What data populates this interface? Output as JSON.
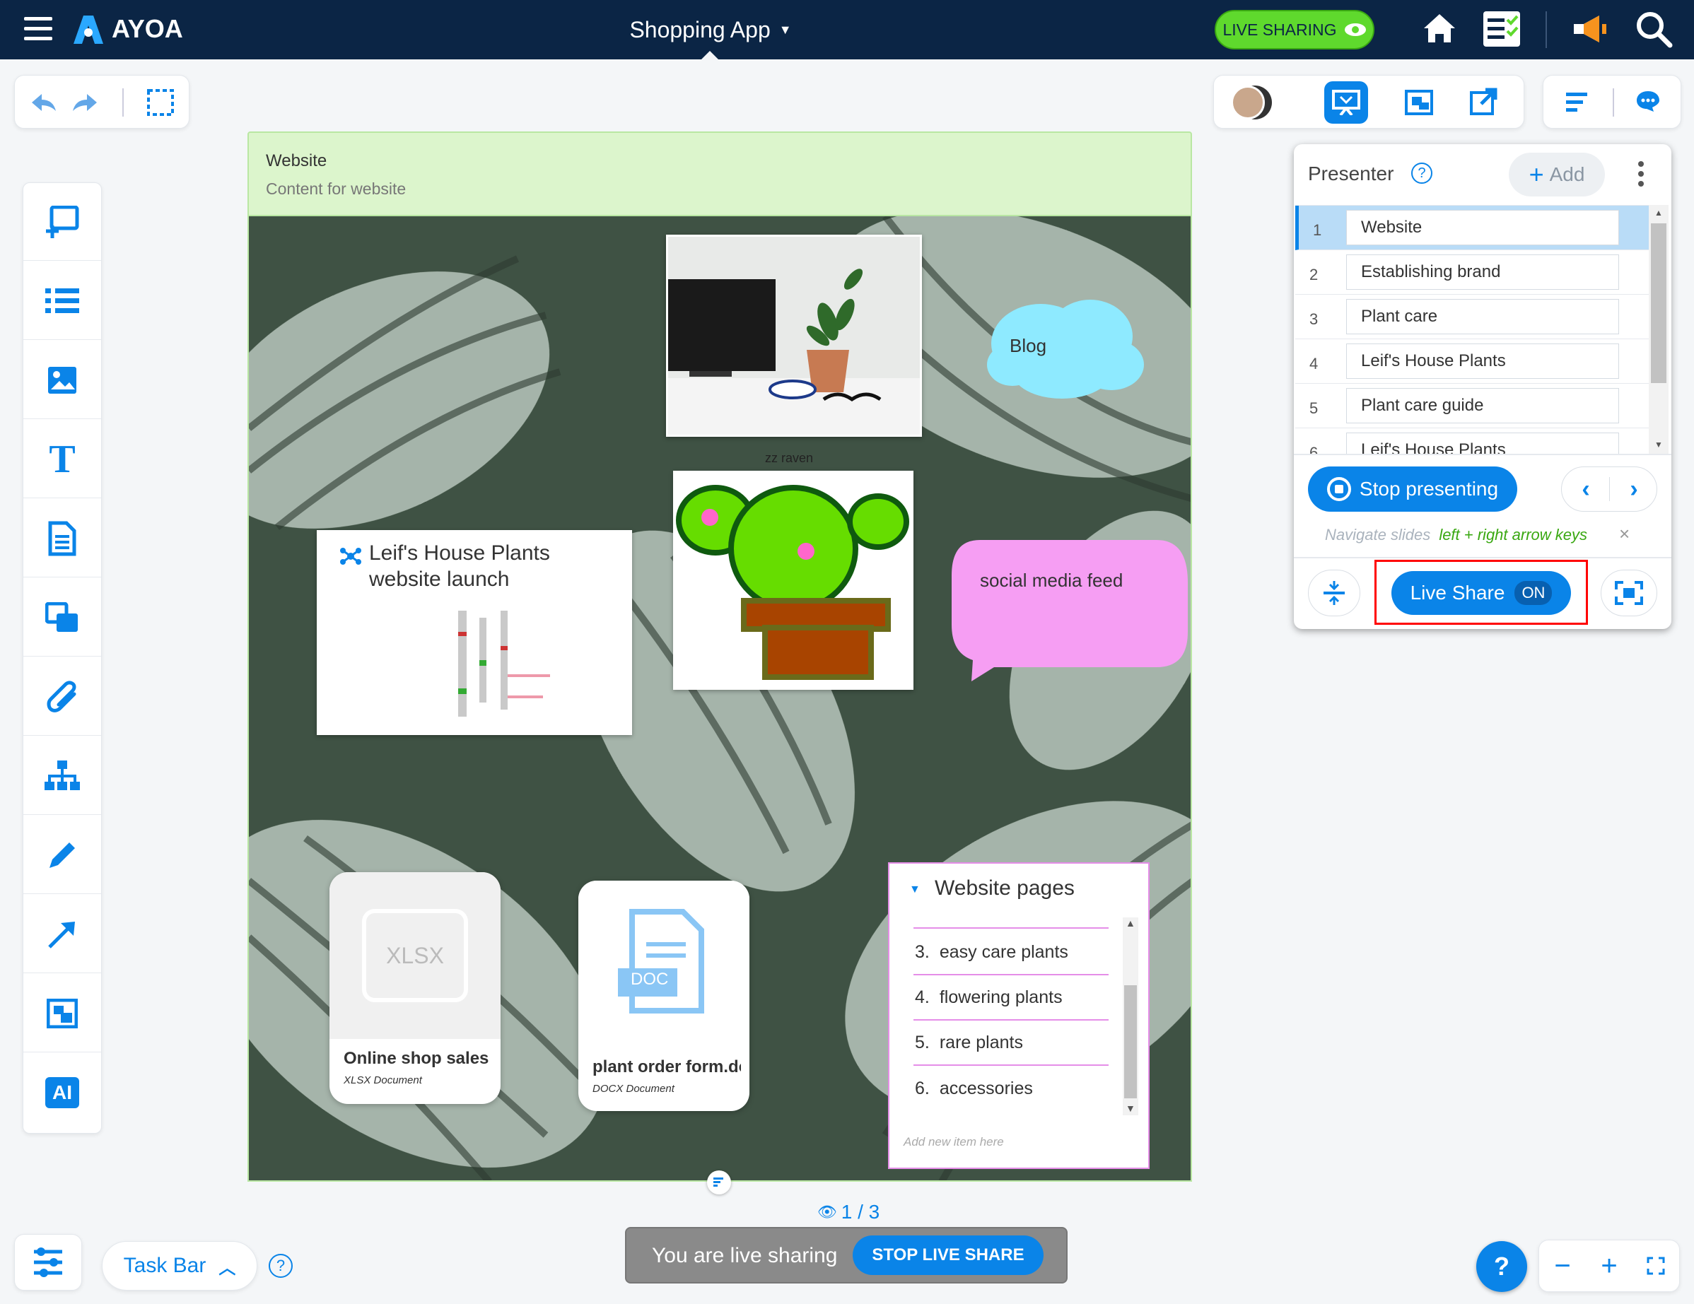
{
  "brand": {
    "name": "AYOA"
  },
  "header": {
    "title": "Shopping App",
    "live_sharing_badge": "LIVE SHARING"
  },
  "board": {
    "frame_title": "Website",
    "frame_subtitle": "Content for website",
    "blog_label": "Blog",
    "image_caption": "zz raven",
    "social_label": "social media feed",
    "mindmap_title": "Leif's House Plants website launch",
    "xlsx_card": {
      "thumb": "XLSX",
      "name": "Online shop sales",
      "type": "XLSX Document"
    },
    "docx_card": {
      "thumb": "DOC",
      "name": "plant order form.docx",
      "type": "DOCX Document"
    },
    "list_card": {
      "title": "Website pages",
      "items": [
        "easy care plants",
        "flowering plants",
        "rare plants",
        "accessories"
      ],
      "numbers": [
        "3.",
        "4.",
        "5.",
        "6."
      ],
      "placeholder": "Add new item here"
    }
  },
  "presenter": {
    "title": "Presenter",
    "add_label": "Add",
    "slides": [
      {
        "num": "1",
        "label": "Website"
      },
      {
        "num": "2",
        "label": "Establishing brand"
      },
      {
        "num": "3",
        "label": "Plant care"
      },
      {
        "num": "4",
        "label": "Leif's House Plants"
      },
      {
        "num": "5",
        "label": "Plant care guide"
      },
      {
        "num": "6",
        "label": "Leif's House Plants"
      }
    ],
    "stop_label": "Stop presenting",
    "hint_prefix": "Navigate slides",
    "hint_keys": "left + right arrow keys",
    "live_share_label": "Live Share",
    "live_share_state": "ON"
  },
  "footer": {
    "viewer_count": "1 / 3",
    "live_text": "You are live sharing",
    "stop_live": "STOP LIVE SHARE",
    "taskbar_label": "Task Bar",
    "help_label": "?"
  },
  "colors": {
    "navy": "#0b2545",
    "accent": "#0a84e8",
    "green_badge": "#5fd92d",
    "frame_header": "#dcf5cc",
    "highlight": "#ff0000"
  }
}
